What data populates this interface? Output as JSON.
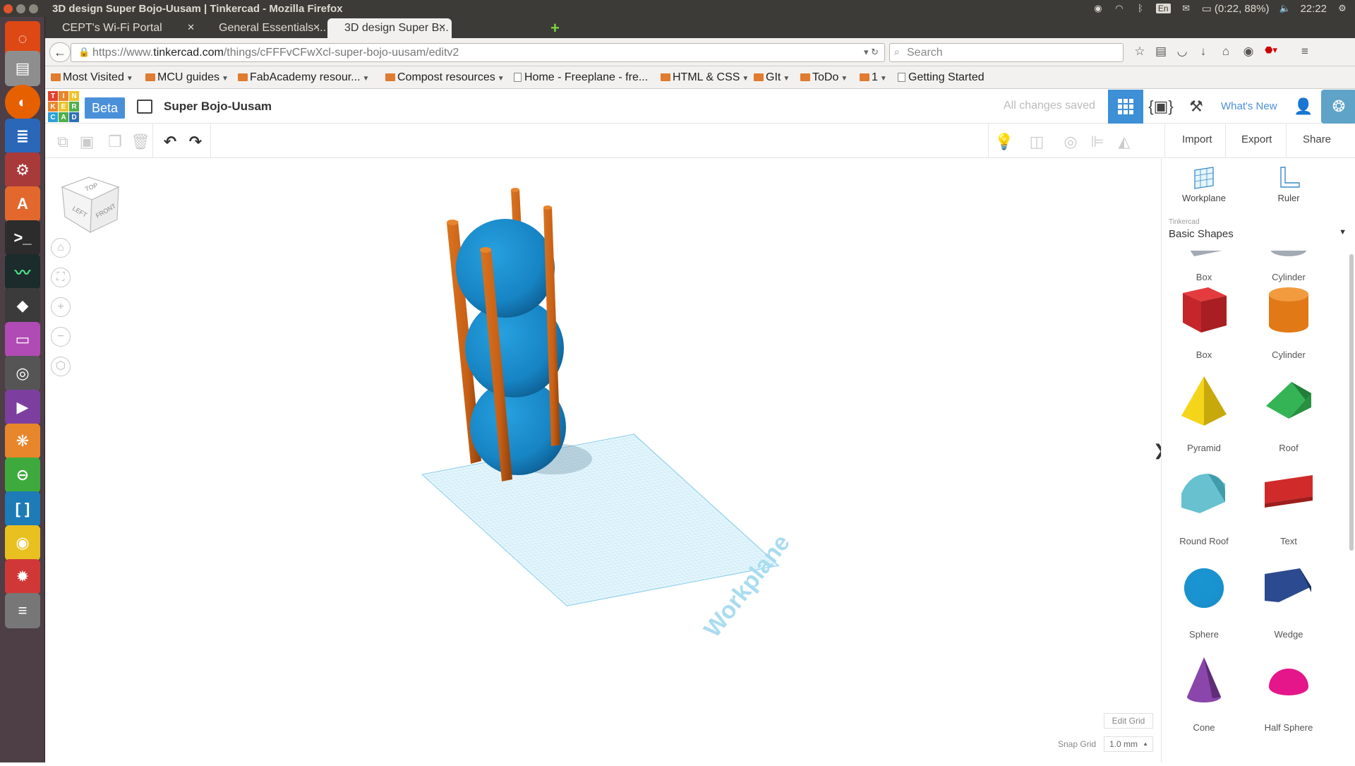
{
  "system": {
    "window_title": "3D design Super Bojo-Uusam | Tinkercad - Mozilla Firefox",
    "keyboard_layout": "En",
    "battery": "(0:22, 88%)",
    "clock": "22:22"
  },
  "browser": {
    "tabs": [
      {
        "label": "CEPT's Wi-Fi Portal"
      },
      {
        "label": "General Essentials ..."
      },
      {
        "label": "3D design Super B..."
      }
    ],
    "url_prefix": "https://www.",
    "url_host": "tinkercad.com",
    "url_path": "/things/cFFFvCFwXcl-super-bojo-uusam/editv2",
    "search_placeholder": "Search",
    "bookmarks": [
      {
        "label": "Most Visited",
        "type": "folder"
      },
      {
        "label": "MCU guides",
        "type": "folder"
      },
      {
        "label": "FabAcademy resour...",
        "type": "folder"
      },
      {
        "label": "Compost resources",
        "type": "folder"
      },
      {
        "label": "Home - Freeplane - fre...",
        "type": "page"
      },
      {
        "label": "HTML & CSS",
        "type": "folder"
      },
      {
        "label": "GIt",
        "type": "folder"
      },
      {
        "label": "ToDo",
        "type": "folder"
      },
      {
        "label": "1",
        "type": "folder"
      },
      {
        "label": "Getting Started",
        "type": "page"
      }
    ]
  },
  "app": {
    "logo_letters": [
      "T",
      "I",
      "N",
      "K",
      "E",
      "R",
      "C",
      "A",
      "D"
    ],
    "beta_label": "Beta",
    "design_name": "Super Bojo-Uusam",
    "save_status": "All changes saved",
    "whats_new": "What's New",
    "toolbar": {
      "import": "Import",
      "export": "Export",
      "share": "Share"
    },
    "viewcube": {
      "top": "TOP",
      "left": "LEFT",
      "front": "FRONT"
    },
    "workplane_label": "Workplane",
    "edit_grid": "Edit Grid",
    "snap_grid_label": "Snap Grid",
    "snap_grid_value": "1.0 mm"
  },
  "panel": {
    "workplane": "Workplane",
    "ruler": "Ruler",
    "library_owner": "Tinkercad",
    "library_name": "Basic Shapes",
    "shapes": [
      {
        "label": "Box",
        "color": "#9aa2ad"
      },
      {
        "label": "Cylinder",
        "color": "#9aa2ad"
      },
      {
        "label": "Box",
        "color": "#d0282e"
      },
      {
        "label": "Cylinder",
        "color": "#e8821e"
      },
      {
        "label": "Pyramid",
        "color": "#f0d00f"
      },
      {
        "label": "Roof",
        "color": "#2fa84f"
      },
      {
        "label": "Round Roof",
        "color": "#5bb6c5"
      },
      {
        "label": "Text",
        "color": "#d02a2a"
      },
      {
        "label": "Sphere",
        "color": "#1a93d0"
      },
      {
        "label": "Wedge",
        "color": "#25407e"
      },
      {
        "label": "Cone",
        "color": "#7a3a9a"
      },
      {
        "label": "Half Sphere",
        "color": "#e01384"
      }
    ]
  },
  "colors": {
    "accent": "#4a90d9",
    "sphere": "#1784c4",
    "rod": "#c75f16",
    "grid": "#bfe6f5"
  }
}
